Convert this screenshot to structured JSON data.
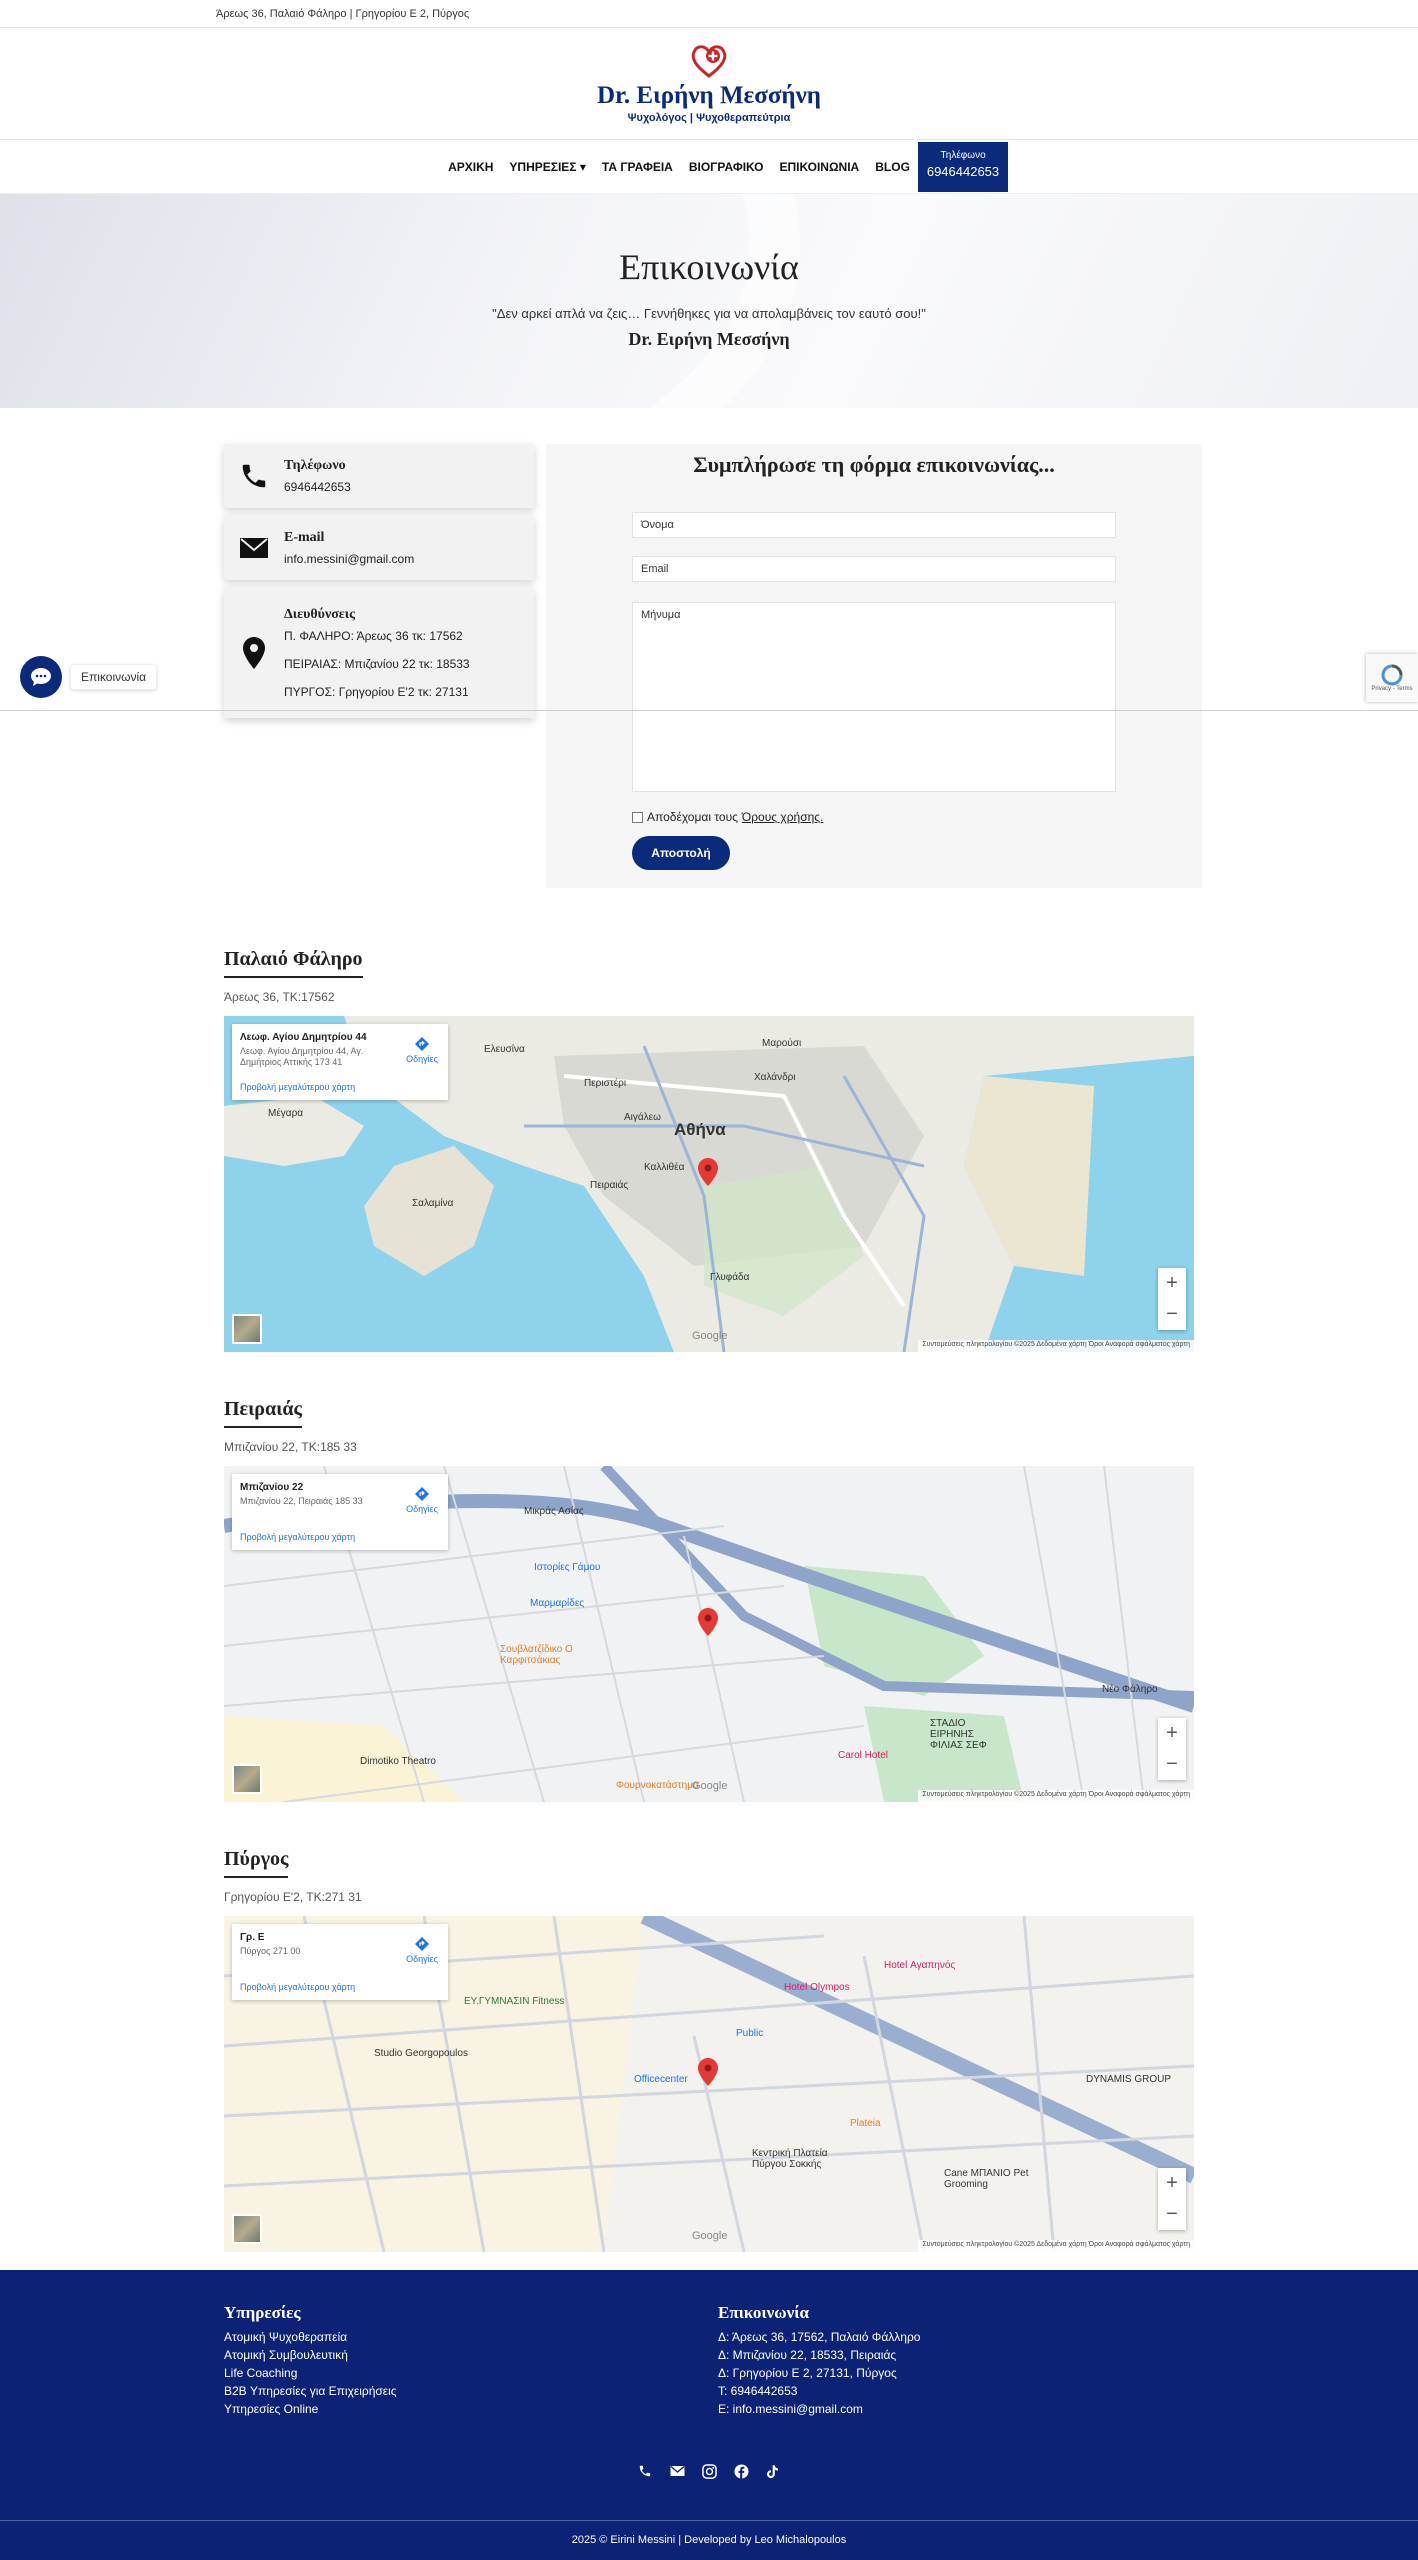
{
  "topbar": {
    "address": "Άρεως 36, Παλαιό Φάληρο | Γρηγορίου Ε 2, Πύργος"
  },
  "header": {
    "title": "Dr. Ειρήνη Μεσσήνη",
    "subtitle": "Ψυχολόγος | Ψυχοθεραπεύτρια"
  },
  "nav": {
    "items": [
      "ΑΡΧΙΚΗ",
      "ΥΠΗΡΕΣΙΕΣ ▾",
      "ΤΑ ΓΡΑΦΕΙΑ",
      "ΒΙΟΓΡΑΦΙΚΟ",
      "ΕΠΙΚΟΙΝΩΝΙΑ",
      "BLOG"
    ],
    "phone_label": "Τηλέφωνο",
    "phone_number": "6946442653"
  },
  "hero": {
    "title": "Επικοινωνία",
    "quote": "\"Δεν αρκεί απλά να ζεις… Γεννήθηκες για να απολαμβάνεις τον εαυτό σου!\"",
    "author": "Dr. Ειρήνη Μεσσήνη"
  },
  "contact_cards": {
    "phone": {
      "title": "Τηλέφωνο",
      "value": "6946442653"
    },
    "email": {
      "title": "E-mail",
      "value": "info.messini@gmail.com"
    },
    "addresses": {
      "title": "Διευθύνσεις",
      "lines": [
        "Π. ΦΑΛΗΡΟ: Άρεως 36 τκ: 17562",
        "ΠΕΙΡΑΙΑΣ: Μπιζανίου 22 τκ: 18533",
        "ΠΥΡΓΟΣ: Γρηγορίου Ε'2 τκ: 27131"
      ]
    }
  },
  "form": {
    "title": "Συμπλήρωσε τη φόρμα επικοινωνίας...",
    "name_placeholder": "Όνομα",
    "email_placeholder": "Email",
    "message_placeholder": "Μήνυμα",
    "terms_prefix": "Αποδέχομαι τους",
    "terms_link": "Όρους χρήσης.",
    "submit_label": "Αποστολή"
  },
  "chat": {
    "label": "Επικοινωνία"
  },
  "recaptcha": {
    "text": "Privacy - Terms"
  },
  "locations": [
    {
      "title": "Παλαιό Φάληρο",
      "address": "Άρεως 36, ΤΚ:17562",
      "card_title": "Λεωφ. Αγίου Δημητρίου 44",
      "card_sub": "Λεωφ. Αγίου Δημητρίου 44, Αγ. Δημήτριος Αττικής 173 41",
      "labels": [
        "Αθήνα",
        "Περιστέρι",
        "Μαρούσι",
        "Χαλάνδρι",
        "Αιγάλεω",
        "Καλλιθέα",
        "Πειραιάς",
        "Γλυφάδα",
        "Σαλαμίνα",
        "Ελευσίνα",
        "Μέγαρα"
      ]
    },
    {
      "title": "Πειραιάς",
      "address": "Μπιζανίου 22, ΤΚ:185 33",
      "card_title": "Μπιζανίου 22",
      "card_sub": "Μπιζανίου 22, Πειραιάς 185 33",
      "labels": [
        "Μικράς Ασίας",
        "Ιστορίες Γάμου",
        "Μαρμαρίδες",
        "Σουβλατζίδικο Ο Καρφιτσάκιας",
        "Νέο Φάληρο",
        "ΣΤΑΔΙΟ ΕΙΡΗΝΗΣ ΦΙΛΙΑΣ ΣΕΦ",
        "Carol Hotel",
        "Dimotiko Theatro",
        "Φουρνοκατάστημα"
      ]
    },
    {
      "title": "Πύργος",
      "address": "Γρηγορίου Ε'2, ΤΚ:271 31",
      "card_title": "Γρ. Ε",
      "card_sub": "Πύργος 271 00",
      "labels": [
        "Hotel Olympos",
        "Hotel Αγαπηνός",
        "ΕΥ.ΓΥΜΝΑΣΙΝ Fitness",
        "Studio Georgopoulos",
        "Officecenter",
        "Public",
        "Plateia",
        "Κεντρική Πλατεία Πύργου Σοκκής",
        "Cane ΜΠΑΝΙΟ Pet Grooming",
        "DYNAMIS GROUP"
      ]
    }
  ],
  "map_common": {
    "directions": "Οδηγίες",
    "larger_map": "Προβολή μεγαλύτερου χάρτη",
    "google": "Google",
    "attribution": "Συντομεύσεις πληκτρολογίου  ©2025 Δεδομένα χάρτη  Όροι  Αναφορά σφάλματος χάρτη"
  },
  "footer": {
    "services_title": "Υπηρεσίες",
    "services": [
      "Ατομική Ψυχοθεραπεία",
      "Ατομική Συμβουλευτική",
      "Life Coaching",
      "B2B Υπηρεσίες για Επιχειρήσεις",
      "Υπηρεσίες Online"
    ],
    "contact_title": "Επικοινωνία",
    "contact": [
      "Δ: Άρεως 36, 17562, Παλαιό Φάλληρο",
      "Δ: Μπιζανίου 22, 18533, Πειραιάς",
      "Δ: Γρηγορίου Ε 2, 27131, Πύργος",
      "Τ: 6946442653",
      "Ε: info.messini@gmail.com"
    ],
    "copyright": "2025 © Eirini Messini | Developed by Leo Michalopoulos"
  },
  "colors": {
    "brand": "#0b2a7c",
    "footer": "#0b2277",
    "pin": "#e53935"
  },
  "icons": [
    "phone-icon",
    "envelope-icon",
    "location-pin-icon",
    "chat-icon",
    "heart-cross-icon",
    "instagram-icon",
    "facebook-icon",
    "tiktok-icon"
  ]
}
